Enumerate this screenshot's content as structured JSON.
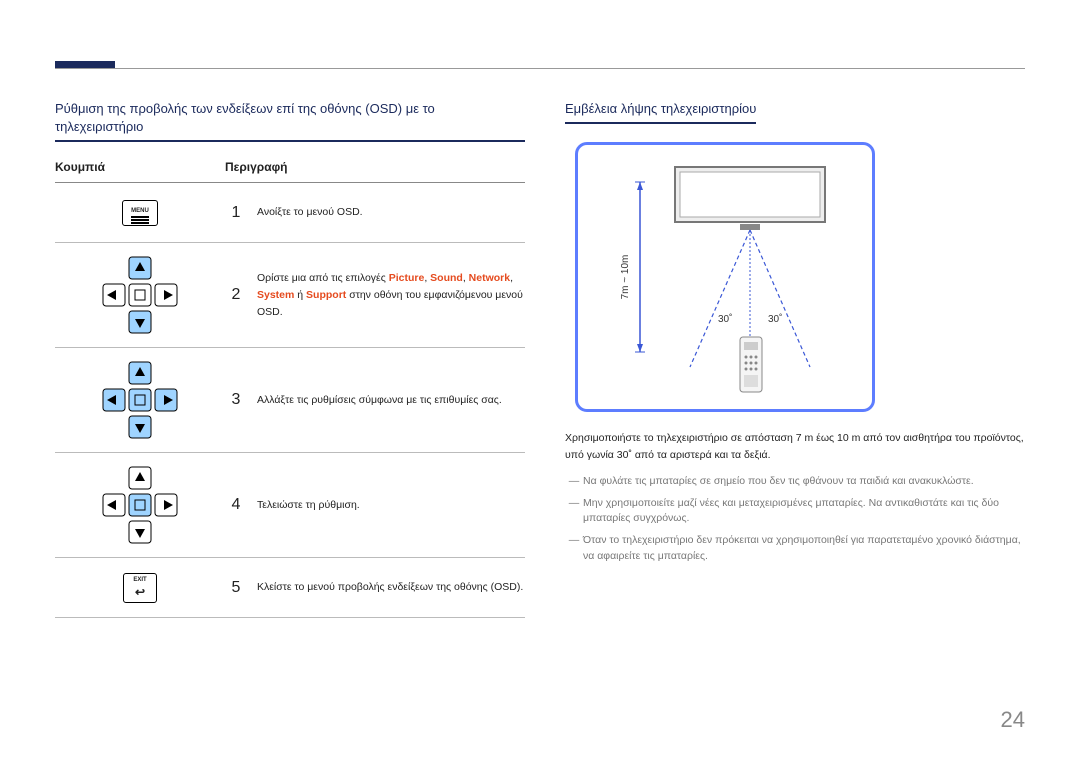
{
  "page_number": "24",
  "left": {
    "title": "Ρύθμιση της προβολής των ενδείξεων επί της οθόνης (OSD) με το τηλεχειριστήριο",
    "th_buttons": "Κουμπιά",
    "th_desc": "Περιγραφή",
    "rows": [
      {
        "num": "1",
        "desc_plain": "Ανοίξτε το μενού OSD."
      },
      {
        "num": "2",
        "desc_pre": "Ορίστε μια από τις επιλογές ",
        "hl1": "Picture",
        "c1": ", ",
        "hl2": "Sound",
        "c2": ", ",
        "hl3": "Network",
        "c3": ", ",
        "hl4": "System",
        "mid": " ή ",
        "hl5": "Support",
        "desc_post": " στην οθόνη του εμφανιζόμενου μενού OSD."
      },
      {
        "num": "3",
        "desc_plain": "Αλλάξτε τις ρυθμίσεις σύμφωνα με τις επιθυμίες σας."
      },
      {
        "num": "4",
        "desc_plain": "Τελειώστε τη ρύθμιση."
      },
      {
        "num": "5",
        "desc_plain": "Κλείστε το μενού προβολής ενδείξεων της οθόνης (OSD)."
      }
    ],
    "menu_label": "MENU",
    "exit_label": "EXIT"
  },
  "right": {
    "title": "Εμβέλεια λήψης τηλεχειριστηρίου",
    "diagram": {
      "distance": "7m ~ 10m",
      "angle_left": "30˚",
      "angle_right": "30˚"
    },
    "range_text": "Χρησιμοποιήστε το τηλεχειριστήριο σε απόσταση 7 m έως 10 m από τον αισθητήρα του προϊόντος, υπό γωνία 30˚ από τα αριστερά και τα δεξιά.",
    "notes": [
      "Να φυλάτε τις μπαταρίες σε σημείο που δεν τις φθάνουν τα παιδιά και ανακυκλώστε.",
      "Μην χρησιμοποιείτε μαζί νέες και μεταχειρισμένες μπαταρίες. Να αντικαθιστάτε και τις δύο μπαταρίες συγχρόνως.",
      "Όταν το τηλεχειριστήριο δεν πρόκειται να χρησιμοποιηθεί για παρατεταμένο χρονικό διάστημα, να αφαιρείτε τις μπαταρίες."
    ]
  }
}
